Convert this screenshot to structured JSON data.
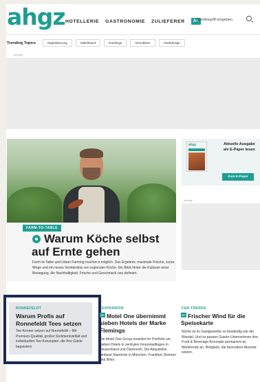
{
  "header": {
    "logo": "ahgz",
    "nav": [
      "HOTELLERIE",
      "GASTRONOMIE",
      "ZULIEFERER"
    ],
    "plus_badge": "A+",
    "search_placeholder": "Suchbegriff eingeben"
  },
  "trending": {
    "label": "Trending Topics",
    "chips": [
      "Digitalisierung",
      "Mittelstand",
      "Rankings",
      "Immobilien",
      "Hoteldesign"
    ]
  },
  "ads": {
    "label": "Anzeige"
  },
  "hero": {
    "kicker": "FARM-TO-TABLE",
    "title": "Warum Köche selbst auf Ernte gehen",
    "text": "Farm-to-Table und Urban Farming machen's möglich. Das Ergebnis: maximale Frische, kurze Wege und ein neues Verständnis von regionaler Küche. Ein Blick hinter die Kulissen einer Bewegung, die Nachhaltigkeit, Frische und Geschmack neu definiert."
  },
  "epaper": {
    "mag_logo": "ahgz",
    "title": "Aktuelle Ausgabe als E-Paper lesen",
    "button": "Zum E-Paper"
  },
  "cards": [
    {
      "kicker": "RONNEFELDT",
      "title": "Warum Profis auf Ronnefeldt Tees setzen",
      "text": "Tee-Kenner setzen auf Ronnefeldt – Mit Premium-Qualität, großer Sortimentvielfalt und individuellen Tee-Konzepten, die Ihre Gäste begeistern"
    },
    {
      "kicker": "EXPANSION",
      "badge": "A+",
      "title": "Motel One übernimmt sieben Hotels der Marke Flemings",
      "text": "Die Motel One Group erweitert ihr Portfolio um sieben Hotels in zentralen Innenstadtlagen in Deutschland und Österreich. Die Akquisition umfasst Standorte in München, Frankfurt, Bremen und Wien."
    },
    {
      "kicker": "F&B-TRENDS",
      "badge": "A+",
      "title": "Frischer Wind für die Speisekarte",
      "text": "Nichts ist im Gastgewerbe so beständig wie der Wandel. Und so passen Gastro-Unternehmen ihre Food & Beverage-Konzepte permanent an Marktrends an. Beispiele, die besondere Akzente setzen."
    }
  ]
}
